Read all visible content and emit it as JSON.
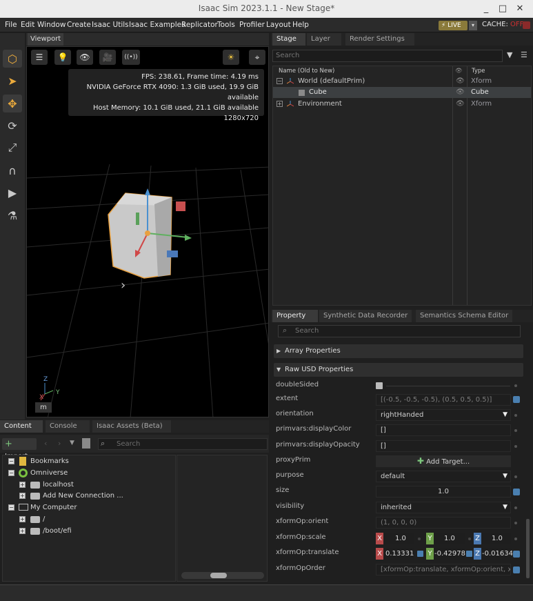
{
  "window": {
    "title": "Isaac Sim 2023.1.1 - New Stage*",
    "minimize": "_",
    "maximize": "□",
    "close": "✕"
  },
  "menu": {
    "items": [
      "File",
      "Edit",
      "Window",
      "Create",
      "Isaac Utils",
      "Isaac Examples",
      "Replicator",
      "Tools",
      "Profiler",
      "Layout",
      "Help"
    ],
    "live": "⚡ LIVE",
    "live_dropdown": "▾",
    "cache_label": "CACHE:",
    "cache_state": "OFF"
  },
  "toolbar": {
    "icons": [
      "cube-select-icon",
      "pointer-icon",
      "move-icon",
      "rotate-icon",
      "scale-icon",
      "snap-icon",
      "play-icon",
      "physics-icon"
    ],
    "glyphs": [
      "⬡",
      "➤",
      "✥",
      "⟳",
      "⤢",
      "∩",
      "▶",
      "⚗"
    ]
  },
  "viewport": {
    "tab": "Viewport",
    "buttons": [
      "☰",
      "💡",
      "👁",
      "🎥",
      "((•))"
    ],
    "right_buttons": [
      "☀",
      "⌖"
    ],
    "stats": {
      "fps": "FPS: 238.61, Frame time: 4.19 ms",
      "gpu": "NVIDIA GeForce RTX 4090: 1.3 GiB used, 19.9 GiB available",
      "host": "Host Memory: 10.1 GiB used, 21.1 GiB available",
      "resolution": "1280x720"
    },
    "gizmo_label": "m",
    "axis_z": "Z",
    "axis_y": "Y",
    "axis_x": "X",
    "chevron": "›"
  },
  "stage": {
    "tabs": [
      "Stage",
      "Layer",
      "Render Settings"
    ],
    "search_placeholder": "Search",
    "col_name": "Name (Old to New)",
    "col_type": "Type",
    "rows": [
      {
        "name": "World (defaultPrim)",
        "type": "Xform",
        "expand": "−"
      },
      {
        "name": "Cube",
        "type": "Cube",
        "expand": ""
      },
      {
        "name": "Environment",
        "type": "Xform",
        "expand": "+"
      }
    ]
  },
  "property": {
    "tabs": [
      "Property",
      "Synthetic Data Recorder",
      "Semantics Schema Editor"
    ],
    "search_placeholder": "Search",
    "sections": {
      "array": "Array Properties",
      "raw": "Raw USD Properties"
    },
    "fields": {
      "doubleSided": "doubleSided",
      "extent": "extent",
      "extent_value": "[(-0.5, -0.5, -0.5), (0.5, 0.5, 0.5)]",
      "orientation": "orientation",
      "orientation_value": "rightHanded",
      "displayColor": "primvars:displayColor",
      "displayColor_value": "[]",
      "displayOpacity": "primvars:displayOpacity",
      "displayOpacity_value": "[]",
      "proxyPrim": "proxyPrim",
      "add_target": "Add Target...",
      "purpose": "purpose",
      "purpose_value": "default",
      "size": "size",
      "size_value": "1.0",
      "visibility": "visibility",
      "visibility_value": "inherited",
      "orient": "xformOp:orient",
      "orient_value": "(1, 0, 0, 0)",
      "scale": "xformOp:scale",
      "scale_x": "1.0",
      "scale_y": "1.0",
      "scale_z": "1.0",
      "translate": "xformOp:translate",
      "translate_x": "0.13331",
      "translate_y": "-0.42978",
      "translate_z": "-0.01634",
      "order": "xformOpOrder",
      "order_value": "[xformOp:translate, xformOp:orient, xformO"
    }
  },
  "content": {
    "tabs": [
      "Content",
      "Console",
      "Isaac Assets (Beta)"
    ],
    "import": "Import",
    "search_placeholder": "Search",
    "tree": [
      {
        "label": "Bookmarks",
        "expand": "−"
      },
      {
        "label": "Omniverse",
        "expand": "−"
      },
      {
        "label": "localhost",
        "expand": "+"
      },
      {
        "label": "Add New Connection ...",
        "expand": "+"
      },
      {
        "label": "My Computer",
        "expand": "−"
      },
      {
        "label": "/",
        "expand": "+"
      },
      {
        "label": "/boot/efi",
        "expand": "+"
      }
    ]
  }
}
